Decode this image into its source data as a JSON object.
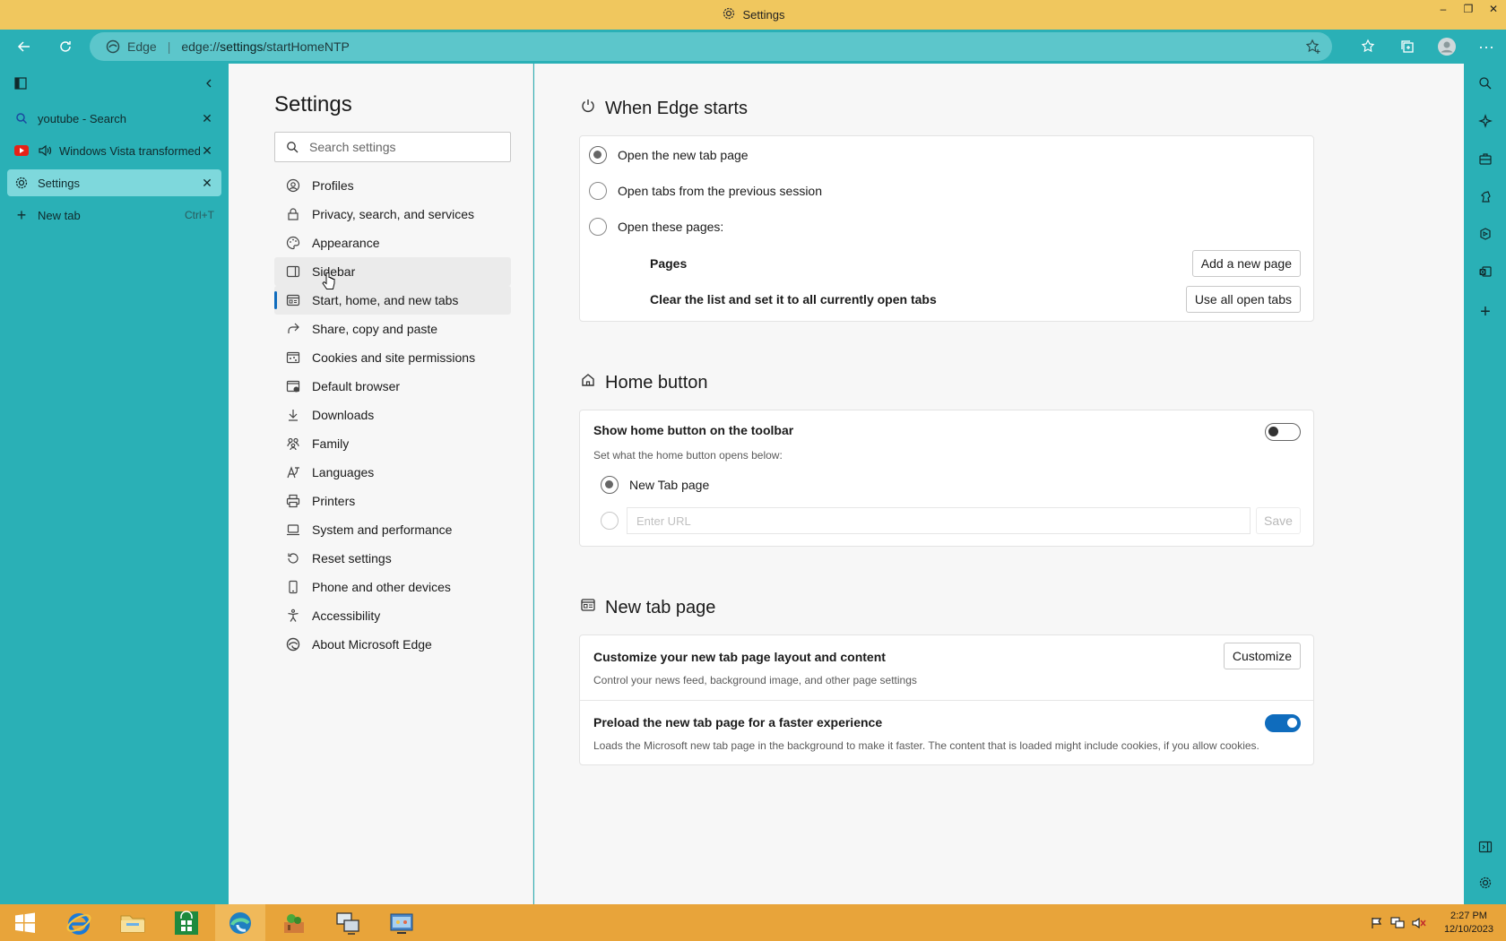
{
  "window": {
    "title": "Settings",
    "minimize": "–",
    "restore": "❐",
    "close": "✕"
  },
  "address": {
    "brand": "Edge",
    "separator": "|",
    "url_prefix": "edge://",
    "url_bold": "settings",
    "url_rest": "/startHomeNTP"
  },
  "vertical_tabs": {
    "tabs": [
      {
        "label": "youtube - Search",
        "icon": "search-icon"
      },
      {
        "label": "Windows Vista transformed",
        "icon": "youtube-icon",
        "audio": true
      },
      {
        "label": "Settings",
        "icon": "gear-icon",
        "active": true
      }
    ],
    "new_tab": {
      "label": "New tab",
      "shortcut": "Ctrl+T"
    }
  },
  "settings_nav": {
    "title": "Settings",
    "search_placeholder": "Search settings",
    "items": [
      {
        "label": "Profiles",
        "icon": "profile-icon"
      },
      {
        "label": "Privacy, search, and services",
        "icon": "lock-icon"
      },
      {
        "label": "Appearance",
        "icon": "palette-icon"
      },
      {
        "label": "Sidebar",
        "icon": "sidebar-icon"
      },
      {
        "label": "Start, home, and new tabs",
        "icon": "home-tabs-icon",
        "selected": true
      },
      {
        "label": "Share, copy and paste",
        "icon": "share-icon"
      },
      {
        "label": "Cookies and site permissions",
        "icon": "cookies-icon"
      },
      {
        "label": "Default browser",
        "icon": "browser-icon"
      },
      {
        "label": "Downloads",
        "icon": "download-icon"
      },
      {
        "label": "Family",
        "icon": "family-icon"
      },
      {
        "label": "Languages",
        "icon": "languages-icon"
      },
      {
        "label": "Printers",
        "icon": "printer-icon"
      },
      {
        "label": "System and performance",
        "icon": "laptop-icon"
      },
      {
        "label": "Reset settings",
        "icon": "reset-icon"
      },
      {
        "label": "Phone and other devices",
        "icon": "phone-icon"
      },
      {
        "label": "Accessibility",
        "icon": "accessibility-icon"
      },
      {
        "label": "About Microsoft Edge",
        "icon": "edge-icon"
      }
    ]
  },
  "when_edge_starts": {
    "title": "When Edge starts",
    "options": [
      {
        "label": "Open the new tab page",
        "checked": true
      },
      {
        "label": "Open tabs from the previous session",
        "checked": false
      },
      {
        "label": "Open these pages:",
        "checked": false
      }
    ],
    "pages_label": "Pages",
    "add_page_button": "Add a new page",
    "clear_list_label": "Clear the list and set it to all currently open tabs",
    "use_all_tabs_button": "Use all open tabs"
  },
  "home_button": {
    "title": "Home button",
    "show_label": "Show home button on the toolbar",
    "show_enabled": false,
    "description": "Set what the home button opens below:",
    "new_tab_option": "New Tab page",
    "url_placeholder": "Enter URL",
    "save_button": "Save"
  },
  "new_tab_page": {
    "title": "New tab page",
    "customize_label": "Customize your new tab page layout and content",
    "customize_desc": "Control your news feed, background image, and other page settings",
    "customize_button": "Customize",
    "preload_label": "Preload the new tab page for a faster experience",
    "preload_desc": "Loads the Microsoft new tab page in the background to make it faster. The content that is loaded might include cookies, if you allow cookies.",
    "preload_enabled": true
  },
  "taskbar": {
    "time": "2:27 PM",
    "date": "12/10/2023"
  },
  "colors": {
    "accent": "#0f6cbd",
    "chrome": "#2ab0b6",
    "titlebar": "#f0c75e",
    "taskbar": "#e8a43a"
  }
}
